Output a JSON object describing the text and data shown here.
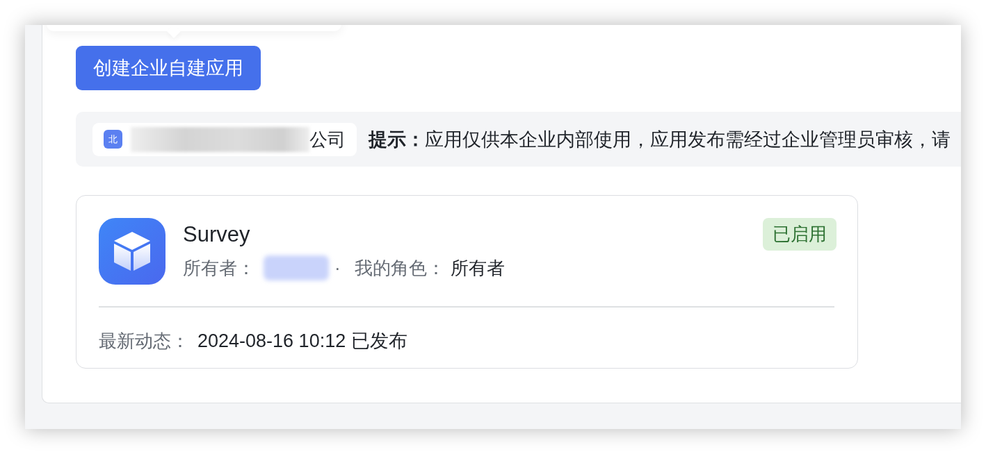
{
  "create_button": {
    "label": "创建企业自建应用"
  },
  "notice_bar": {
    "organization": {
      "icon_text": "北",
      "name_redacted": true,
      "name_suffix": "公司"
    },
    "message": "**提示：**应用仅供本企业内部使用，应用发布需经过企业管理员审核，请"
  },
  "apps": [
    {
      "name": "Survey",
      "status": {
        "label": "已启用",
        "enabled": true
      },
      "owner_label": "所有者：",
      "owner_redacted": true,
      "separator": "·",
      "role_label": "我的角色：",
      "role": "所有者",
      "activity_label": "最新动态：",
      "activity": "2024-08-16 10:12 已发布"
    }
  ]
}
